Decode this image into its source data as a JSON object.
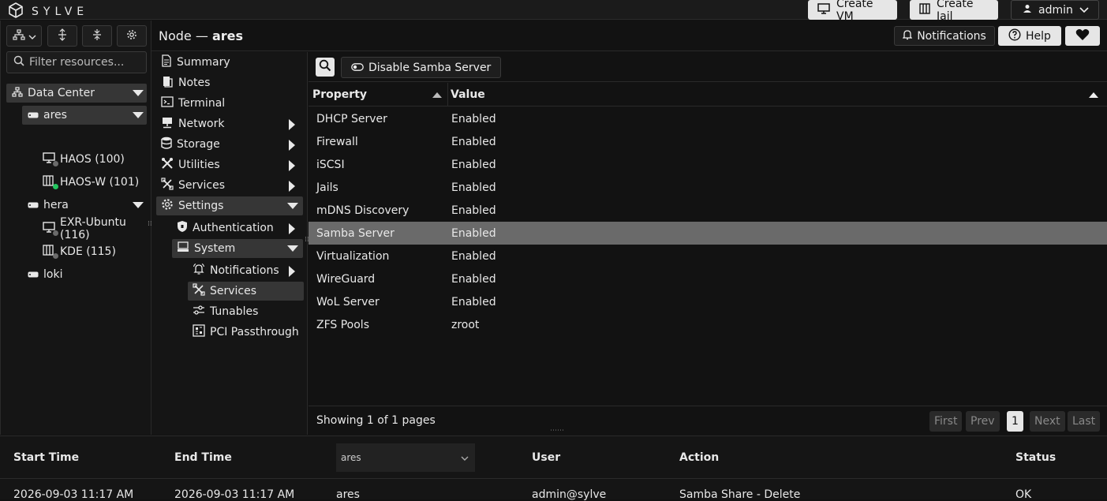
{
  "brand": {
    "name": "SYLVE",
    "logo_icon": "cube-icon"
  },
  "topbar": {
    "create_vm": "Create VM",
    "create_jail": "Create Jail",
    "user": "admin"
  },
  "left": {
    "filter_placeholder": "Filter resources...",
    "tree": [
      {
        "label": "Data Center",
        "icon": "datacenter-icon"
      },
      {
        "label": "ares",
        "icon": "server-icon"
      },
      {
        "label": "HAOS (100)",
        "icon": "vm-icon",
        "status": "stopped"
      },
      {
        "label": "HAOS-W (101)",
        "icon": "jail-icon",
        "status": "running"
      },
      {
        "label": "hera",
        "icon": "server-icon"
      },
      {
        "label": "EXR-Ubuntu (116)",
        "icon": "vm-icon",
        "status": "stopped"
      },
      {
        "label": "KDE (115)",
        "icon": "jail-icon",
        "status": "stopped"
      },
      {
        "label": "loki",
        "icon": "server-icon"
      }
    ]
  },
  "header": {
    "node_prefix": "Node —",
    "node_name": "ares",
    "notifications": "Notifications",
    "help": "Help"
  },
  "nav": [
    {
      "label": "Summary"
    },
    {
      "label": "Notes"
    },
    {
      "label": "Terminal"
    },
    {
      "label": "Network"
    },
    {
      "label": "Storage"
    },
    {
      "label": "Utilities"
    },
    {
      "label": "Services"
    },
    {
      "label": "Settings"
    },
    {
      "label": "Authentication"
    },
    {
      "label": "System"
    },
    {
      "label": "Notifications"
    },
    {
      "label": "Services"
    },
    {
      "label": "Tunables"
    },
    {
      "label": "PCI Passthrough"
    }
  ],
  "toolbar": {
    "disable_label": "Disable Samba Server"
  },
  "table": {
    "headers": {
      "property": "Property",
      "value": "Value"
    },
    "rows": [
      {
        "property": "DHCP Server",
        "value": "Enabled"
      },
      {
        "property": "Firewall",
        "value": "Enabled"
      },
      {
        "property": "iSCSI",
        "value": "Enabled"
      },
      {
        "property": "Jails",
        "value": "Enabled"
      },
      {
        "property": "mDNS Discovery",
        "value": "Enabled"
      },
      {
        "property": "Samba Server",
        "value": "Enabled"
      },
      {
        "property": "Virtualization",
        "value": "Enabled"
      },
      {
        "property": "WireGuard",
        "value": "Enabled"
      },
      {
        "property": "WoL Server",
        "value": "Enabled"
      },
      {
        "property": "ZFS Pools",
        "value": "zroot"
      }
    ],
    "selected_row": 5,
    "showing": "Showing 1 of 1 pages",
    "pager": {
      "first": "First",
      "prev": "Prev",
      "page": "1",
      "next": "Next",
      "last": "Last"
    }
  },
  "audit": {
    "headers": {
      "start": "Start Time",
      "end": "End Time",
      "node_filter": "ares",
      "user": "User",
      "action": "Action",
      "status": "Status"
    },
    "row": {
      "start": "2026-09-03 11:17 AM",
      "end": "2026-09-03 11:17 AM",
      "node": "ares",
      "user": "admin@sylve",
      "action": "Samba Share - Delete",
      "status": "OK"
    }
  },
  "colors": {
    "running": "#22c55e",
    "stopped": "#6b6b6b",
    "selected_row": "#6a6a6a"
  }
}
